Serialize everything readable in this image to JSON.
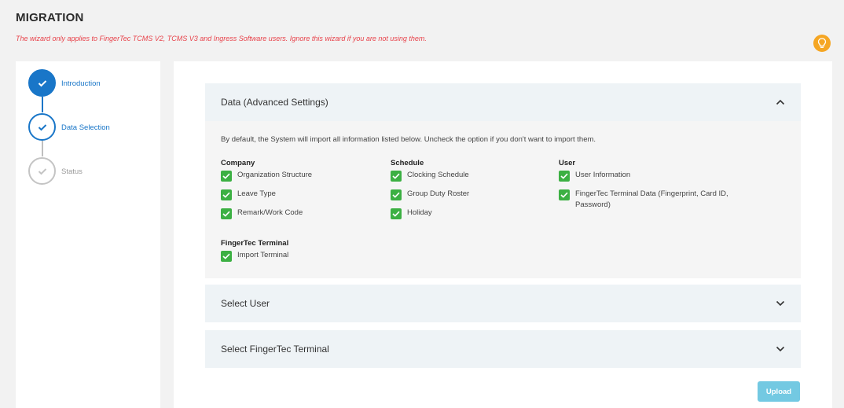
{
  "page": {
    "title": "MIGRATION",
    "warning": "The wizard only applies to FingerTec TCMS V2, TCMS V3 and Ingress Software users. Ignore this wizard if you are not using them."
  },
  "icons": {
    "tip": "lightbulb-icon",
    "check": "check-icon",
    "chevron_up": "chevron-up-icon",
    "chevron_down": "chevron-down-icon"
  },
  "colors": {
    "accent": "#1976c8",
    "checkbox": "#3cb043",
    "warning": "#e8424a",
    "upload": "#5bc0de",
    "tip": "#f5a623"
  },
  "steps": [
    {
      "label": "Introduction",
      "state": "done"
    },
    {
      "label": "Data Selection",
      "state": "current"
    },
    {
      "label": "Status",
      "state": "pending"
    }
  ],
  "data_section": {
    "title": "Data (Advanced Settings)",
    "expanded": true,
    "description": "By default, the System will import all information listed below. Uncheck the option if you don't want to import them.",
    "groups": {
      "company": {
        "title": "Company",
        "items": [
          {
            "label": "Organization Structure",
            "checked": true
          },
          {
            "label": "Leave Type",
            "checked": true
          },
          {
            "label": "Remark/Work Code",
            "checked": true
          }
        ]
      },
      "schedule": {
        "title": "Schedule",
        "items": [
          {
            "label": "Clocking Schedule",
            "checked": true
          },
          {
            "label": "Group Duty Roster",
            "checked": true
          },
          {
            "label": "Holiday",
            "checked": true
          }
        ]
      },
      "user": {
        "title": "User",
        "items": [
          {
            "label": "User Information",
            "checked": true
          },
          {
            "label": "FingerTec Terminal Data (Fingerprint, Card ID, Password)",
            "checked": true
          }
        ]
      },
      "terminal": {
        "title": "FingerTec Terminal",
        "items": [
          {
            "label": "Import Terminal",
            "checked": true
          }
        ]
      }
    }
  },
  "select_user": {
    "title": "Select User",
    "expanded": false
  },
  "select_terminal": {
    "title": "Select FingerTec Terminal",
    "expanded": false
  },
  "upload_label": "Upload"
}
